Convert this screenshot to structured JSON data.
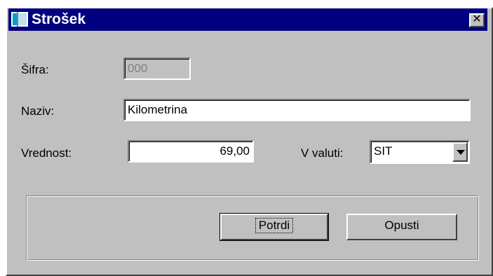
{
  "window": {
    "title": "Strošek",
    "close_glyph": "✕"
  },
  "form": {
    "sifra_label": "Šifra:",
    "sifra_value": "000",
    "naziv_label": "Naziv:",
    "naziv_value": "Kilometrina",
    "vrednost_label": "Vrednost:",
    "vrednost_value": "69,00",
    "valuta_label": "V valuti:",
    "valuta_value": "SIT"
  },
  "buttons": {
    "confirm_label": "Potrdi",
    "cancel_label": "Opusti"
  },
  "colors": {
    "titlebar": "#000080",
    "face": "#c0c0c0"
  },
  "icons": {
    "title": "window-icon",
    "close": "close-icon",
    "dropdown": "chevron-down-icon"
  }
}
